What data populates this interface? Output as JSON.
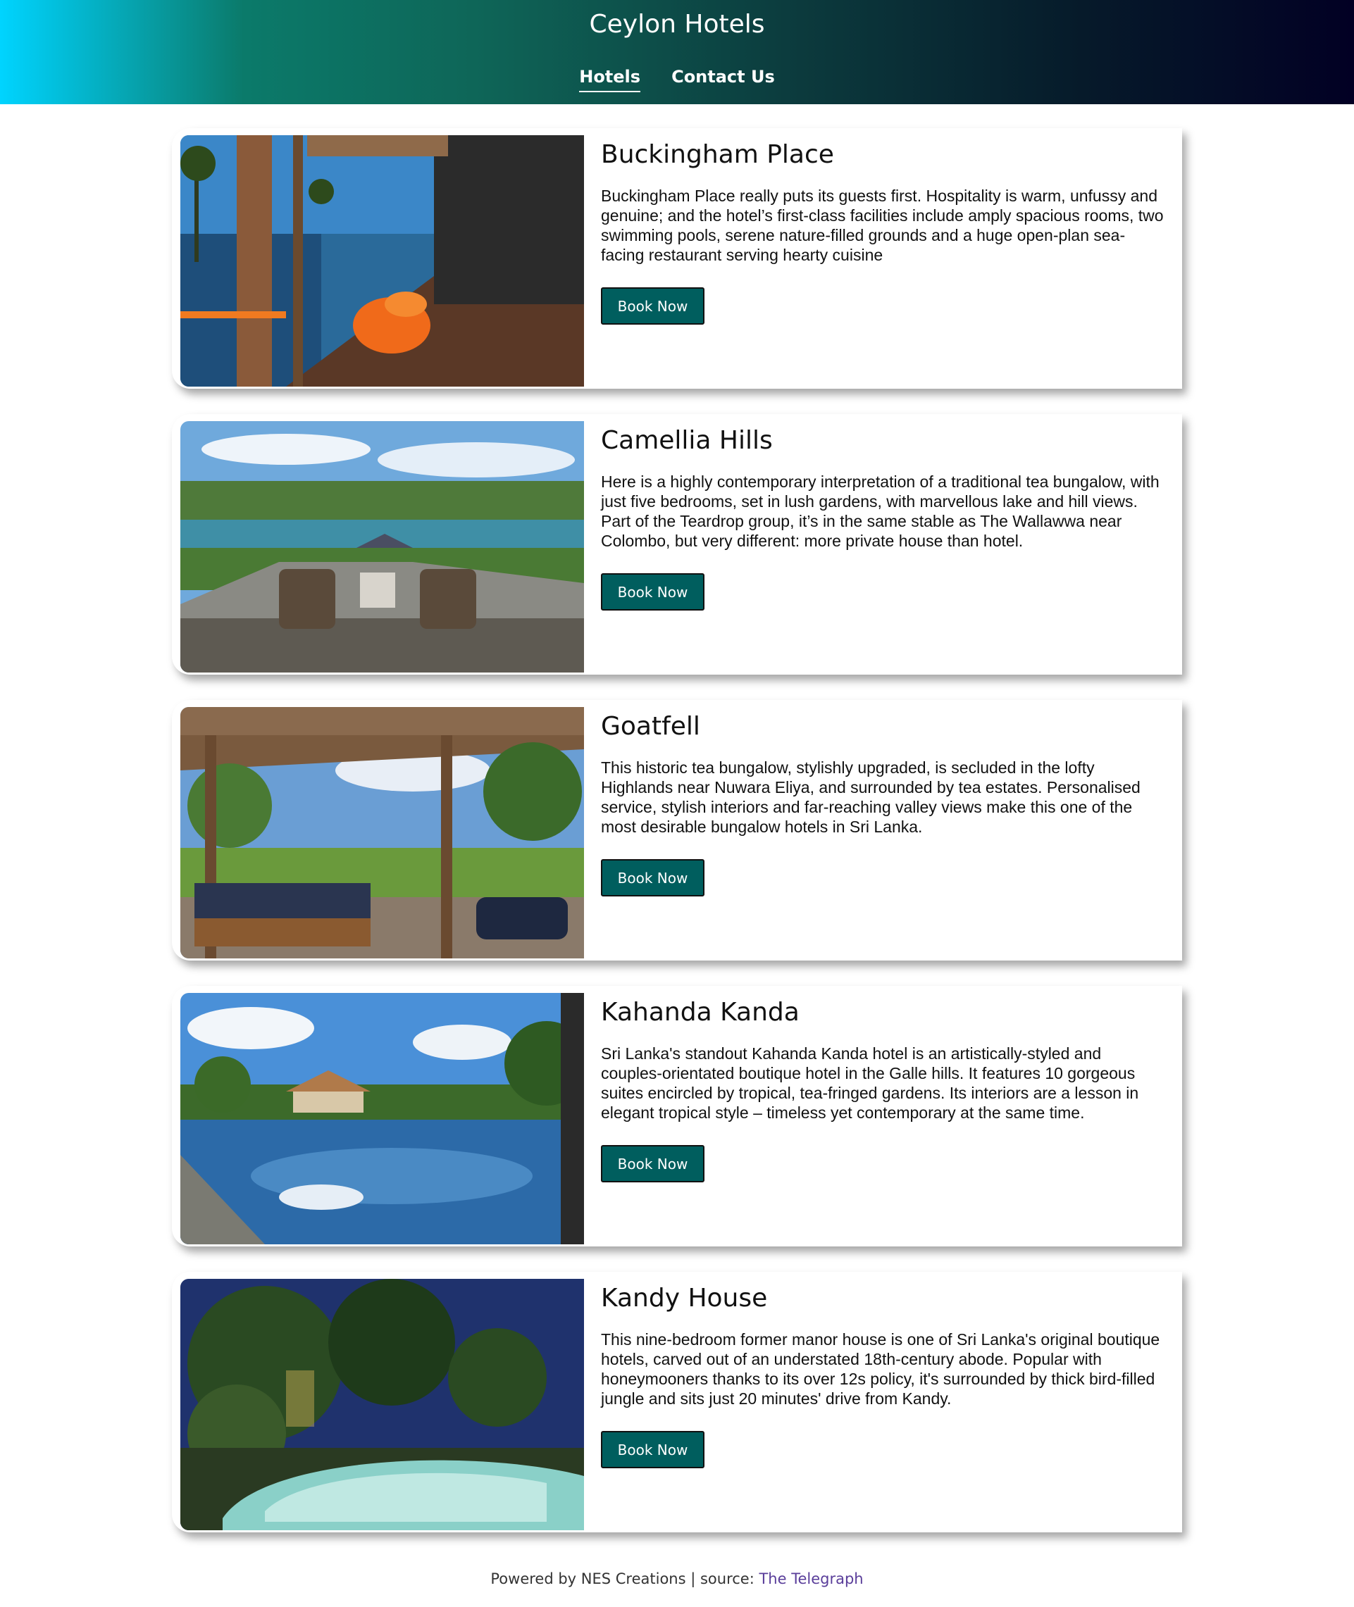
{
  "header": {
    "title": "Ceylon Hotels",
    "nav": [
      {
        "label": "Hotels"
      },
      {
        "label": "Contact Us"
      }
    ]
  },
  "hotels": [
    {
      "name": "Buckingham Place",
      "description": "Buckingham Place really puts its guests first. Hospitality is warm, unfussy and genuine; and the hotel’s first-class facilities include amply spacious rooms, two swimming pools, serene nature-filled grounds and a huge open-plan sea-facing restaurant serving hearty cuisine",
      "button_label": "Book Now"
    },
    {
      "name": "Camellia Hills",
      "description": "Here is a highly contemporary interpretation of a traditional tea bungalow, with just five bedrooms, set in lush gardens, with marvellous lake and hill views. Part of the Teardrop group, it’s in the same stable as The Wallawwa near Colombo, but very different: more private house than hotel.",
      "button_label": "Book Now"
    },
    {
      "name": "Goatfell",
      "description": "This historic tea bungalow, stylishly upgraded, is secluded in the lofty Highlands near Nuwara Eliya, and surrounded by tea estates. Personalised service, stylish interiors and far-reaching valley views make this one of the most desirable bungalow hotels in Sri Lanka.",
      "button_label": "Book Now"
    },
    {
      "name": "Kahanda Kanda",
      "description": "Sri Lanka's standout Kahanda Kanda hotel is an artistically-styled and couples-orientated boutique hotel in the Galle hills. It features 10 gorgeous suites encircled by tropical, tea-fringed gardens. Its interiors are a lesson in elegant tropical style – timeless yet contemporary at the same time.",
      "button_label": "Book Now"
    },
    {
      "name": "Kandy House",
      "description": "This nine-bedroom former manor house is one of Sri Lanka's original boutique hotels, carved out of an understated 18th-century abode. Popular with honeymooners thanks to its over 12s policy, it's surrounded by thick bird-filled jungle and sits just 20 minutes' drive from Kandy.",
      "button_label": "Book Now"
    }
  ],
  "footer": {
    "text": "Powered by NES Creations | source: ",
    "link_label": "The Telegraph"
  }
}
